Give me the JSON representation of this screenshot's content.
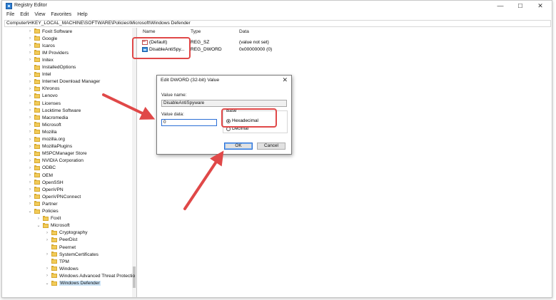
{
  "window": {
    "title": "Registry Editor",
    "buttons": {
      "minimize": "—",
      "maximize": "☐",
      "close": "✕"
    }
  },
  "menu": [
    "File",
    "Edit",
    "View",
    "Favorites",
    "Help"
  ],
  "address": "Computer\\HKEY_LOCAL_MACHINE\\SOFTWARE\\Policies\\Microsoft\\Windows Defender",
  "tree": {
    "rows": [
      {
        "label": "Foxit Software",
        "depth": 0,
        "expander": "›"
      },
      {
        "label": "Google",
        "depth": 0,
        "expander": "›"
      },
      {
        "label": "Icaros",
        "depth": 0,
        "expander": "›"
      },
      {
        "label": "IM Providers",
        "depth": 0,
        "expander": "›"
      },
      {
        "label": "Initex",
        "depth": 0,
        "expander": "›"
      },
      {
        "label": "InstalledOptions",
        "depth": 0,
        "expander": ""
      },
      {
        "label": "Intel",
        "depth": 0,
        "expander": "›"
      },
      {
        "label": "Internet Download Manager",
        "depth": 0,
        "expander": "›"
      },
      {
        "label": "Khronos",
        "depth": 0,
        "expander": "›"
      },
      {
        "label": "Lenovo",
        "depth": 0,
        "expander": "›"
      },
      {
        "label": "Licenses",
        "depth": 0,
        "expander": "›"
      },
      {
        "label": "Locktime Software",
        "depth": 0,
        "expander": "›"
      },
      {
        "label": "Macromedia",
        "depth": 0,
        "expander": "›"
      },
      {
        "label": "Microsoft",
        "depth": 0,
        "expander": "›"
      },
      {
        "label": "Mozilla",
        "depth": 0,
        "expander": "›"
      },
      {
        "label": "mozilla.org",
        "depth": 0,
        "expander": "›"
      },
      {
        "label": "MozillaPlugins",
        "depth": 0,
        "expander": "›"
      },
      {
        "label": "MSPCManager Store",
        "depth": 0,
        "expander": "›"
      },
      {
        "label": "NVIDIA Corporation",
        "depth": 0,
        "expander": "›"
      },
      {
        "label": "ODBC",
        "depth": 0,
        "expander": "›"
      },
      {
        "label": "OEM",
        "depth": 0,
        "expander": "›"
      },
      {
        "label": "OpenSSH",
        "depth": 0,
        "expander": "›"
      },
      {
        "label": "OpenVPN",
        "depth": 0,
        "expander": "›"
      },
      {
        "label": "OpenVPNConnect",
        "depth": 0,
        "expander": "›"
      },
      {
        "label": "Partner",
        "depth": 0,
        "expander": "›"
      },
      {
        "label": "Policies",
        "depth": 0,
        "expander": "⌄"
      },
      {
        "label": "Foxit",
        "depth": 1,
        "expander": "›"
      },
      {
        "label": "Microsoft",
        "depth": 1,
        "expander": "⌄"
      },
      {
        "label": "Cryptography",
        "depth": 2,
        "expander": "›"
      },
      {
        "label": "PeerDist",
        "depth": 2,
        "expander": "›"
      },
      {
        "label": "Peernet",
        "depth": 2,
        "expander": ""
      },
      {
        "label": "SystemCertificates",
        "depth": 2,
        "expander": "›"
      },
      {
        "label": "TPM",
        "depth": 2,
        "expander": ""
      },
      {
        "label": "Windows",
        "depth": 2,
        "expander": "›"
      },
      {
        "label": "Windows Advanced Threat Protectio",
        "depth": 2,
        "expander": "›"
      },
      {
        "label": "Windows Defender",
        "depth": 2,
        "expander": "⌄",
        "selected": true
      }
    ]
  },
  "values_pane": {
    "columns": {
      "name": "Name",
      "type": "Type",
      "data": "Data"
    },
    "rows": [
      {
        "name": "(Default)",
        "type": "REG_SZ",
        "data": "(value not set)",
        "icon": "string-value-icon"
      },
      {
        "name": "DisableAntiSpy...",
        "type": "REG_DWORD",
        "data": "0x00000000 (0)",
        "icon": "dword-value-icon"
      }
    ]
  },
  "dialog": {
    "title": "Edit DWORD (32-bit) Value",
    "close": "✕",
    "value_name_label": "Value name:",
    "value_name": "DisableAntiSpyware",
    "value_data_label": "Value data:",
    "value_data": "0",
    "base_label": "Base",
    "radio_hex": "Hexadecimal",
    "radio_dec": "Decimal",
    "ok": "OK",
    "cancel": "Cancel"
  },
  "annotation_color": "#e04848"
}
